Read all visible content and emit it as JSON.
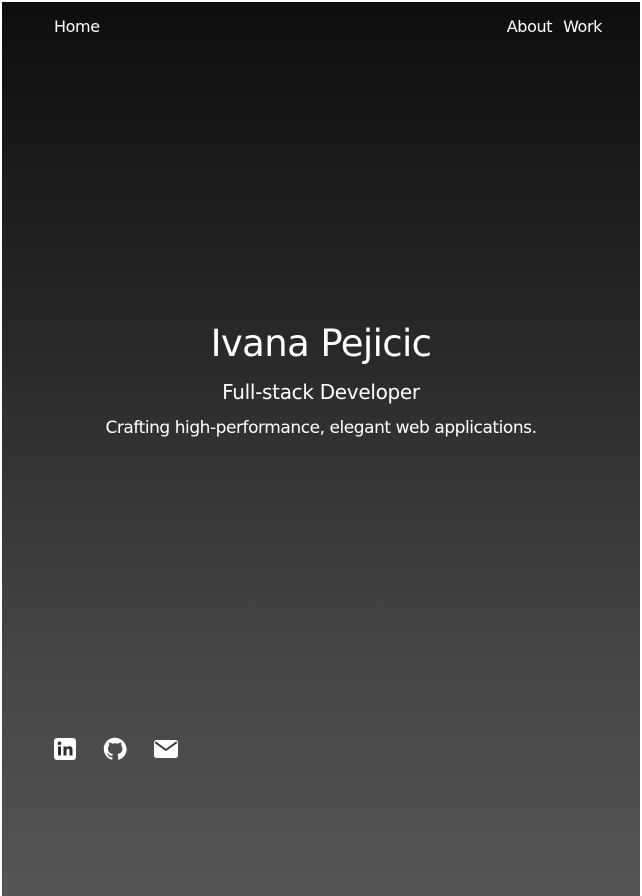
{
  "nav": {
    "home": "Home",
    "about": "About",
    "work": "Work"
  },
  "hero": {
    "name": "Ivana Pejicic",
    "role": "Full-stack Developer",
    "tagline": "Crafting high-performance, elegant web applications."
  },
  "social": [
    {
      "icon": "linkedin-icon"
    },
    {
      "icon": "github-icon"
    },
    {
      "icon": "mail-icon"
    }
  ],
  "colors": {
    "text": "#ffffff",
    "background_top": "#0e0e0e",
    "background_bottom": "#555555"
  }
}
